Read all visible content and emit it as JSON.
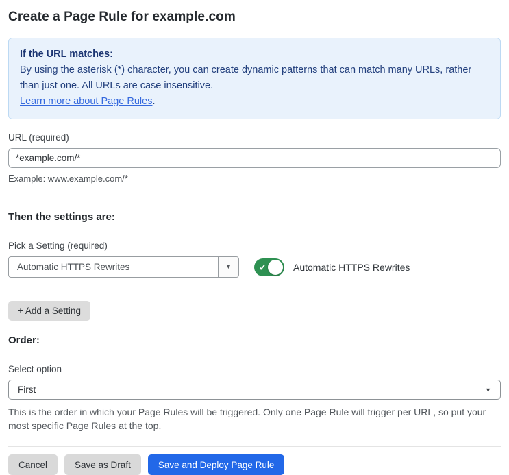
{
  "page": {
    "title": "Create a Page Rule for example.com"
  },
  "info_box": {
    "heading": "If the URL matches:",
    "body": "By using the asterisk (*) character, you can create dynamic patterns that can match many URLs, rather than just one. All URLs are case insensitive.",
    "link_label": "Learn more about Page Rules",
    "link_suffix": "."
  },
  "url_field": {
    "label": "URL (required)",
    "value": "*example.com/*",
    "help": "Example: www.example.com/*"
  },
  "settings_section": {
    "heading": "Then the settings are:",
    "picker_label": "Pick a Setting (required)",
    "picker_value": "Automatic HTTPS Rewrites",
    "toggle_label": "Automatic HTTPS Rewrites",
    "toggle_state": "on",
    "add_button_label": "+ Add a Setting"
  },
  "order_section": {
    "heading": "Order:",
    "select_label": "Select option",
    "select_value": "First",
    "help": "This is the order in which your Page Rules will be triggered. Only one Page Rule will trigger per URL, so put your most specific Page Rules at the top."
  },
  "footer": {
    "cancel_label": "Cancel",
    "save_draft_label": "Save as Draft",
    "deploy_label": "Save and Deploy Page Rule"
  },
  "icons": {
    "dropdown_arrow": "▼",
    "select_arrow": "▼",
    "toggle_check": "✓"
  },
  "colors": {
    "accent_blue": "#2268e8",
    "toggle_green": "#2e9152",
    "info_bg": "#e9f2fc",
    "info_border": "#bcd9f3",
    "info_text": "#24417e",
    "link_blue": "#3569de"
  }
}
